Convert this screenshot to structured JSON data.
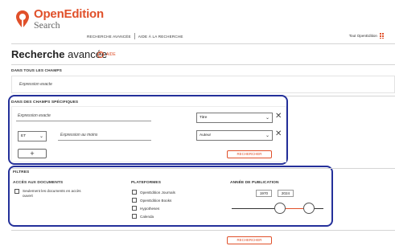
{
  "header": {
    "brand": "OpenEdition",
    "brand_sub": "Search",
    "nav": [
      "Recherche avancée",
      "Aide à la recherche"
    ],
    "platform_menu": "Tout OpenEdition",
    "colors": {
      "brand": "#e0502a",
      "highlight": "#24309a"
    }
  },
  "page": {
    "title_bold": "Recherche",
    "title_rest": " avancée",
    "help": "Aide"
  },
  "all_fields": {
    "label": "Dans tous les champs",
    "placeholder": "Expression exacte"
  },
  "specific_fields": {
    "label": "Dans des champs spécifiques",
    "row1_text": "Expression exacte",
    "row1_field": "Titre",
    "row2_operator": "ET",
    "row2_text": "Expression au moins",
    "row2_field": "Auteur",
    "add": "+",
    "search": "Rechercher"
  },
  "filters": {
    "label": "Filtres",
    "access": {
      "title": "Accès aux documents",
      "option": "Seulement les documents en accès ouvert"
    },
    "platforms": {
      "title": "Plateformes",
      "options": [
        "OpenEdition Journals",
        "OpenEdition Books",
        "Hypotheses",
        "Calenda"
      ]
    },
    "year": {
      "title": "Année de publication",
      "from": "1970",
      "to": "2024"
    }
  },
  "bottom": {
    "search": "Rechercher"
  }
}
